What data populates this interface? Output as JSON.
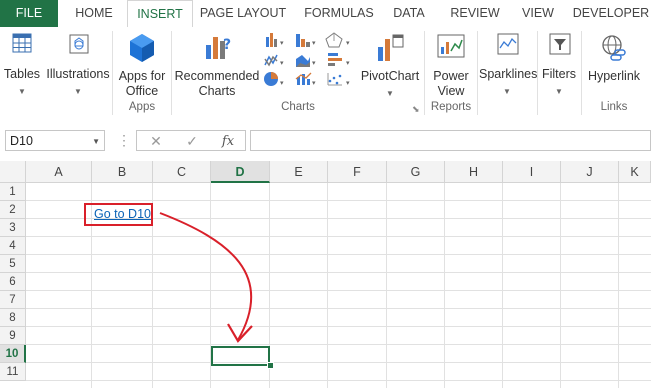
{
  "ribbon_tabs": [
    "FILE",
    "HOME",
    "INSERT",
    "PAGE LAYOUT",
    "FORMULAS",
    "DATA",
    "REVIEW",
    "VIEW",
    "DEVELOPER"
  ],
  "active_tab": "INSERT",
  "ribbon": {
    "tables": "Tables",
    "illustrations": "Illustrations",
    "apps_line1": "Apps for",
    "apps_line2": "Office",
    "recommended_line1": "Recommended",
    "recommended_line2": "Charts",
    "pivotchart": "PivotChart",
    "powerview_line1": "Power",
    "powerview_line2": "View",
    "sparklines": "Sparklines",
    "filters": "Filters",
    "hyperlink": "Hyperlink",
    "group_apps": "Apps",
    "group_charts": "Charts",
    "group_reports": "Reports",
    "group_links": "Links"
  },
  "formula_bar": {
    "name_box": "D10",
    "cancel_symbol": "✕",
    "enter_symbol": "✓",
    "fx_symbol": "fx",
    "formula": ""
  },
  "columns": [
    "A",
    "B",
    "C",
    "D",
    "E",
    "F",
    "G",
    "H",
    "I",
    "J",
    "K"
  ],
  "rows": [
    "1",
    "2",
    "3",
    "4",
    "5",
    "6",
    "7",
    "8",
    "9",
    "10",
    "11"
  ],
  "selected_cell": "D10",
  "cells": {
    "B2": "Go to D10"
  },
  "colors": {
    "excel_green": "#217346",
    "link_blue": "#0b63b6",
    "annotation_red": "#d9202a"
  }
}
